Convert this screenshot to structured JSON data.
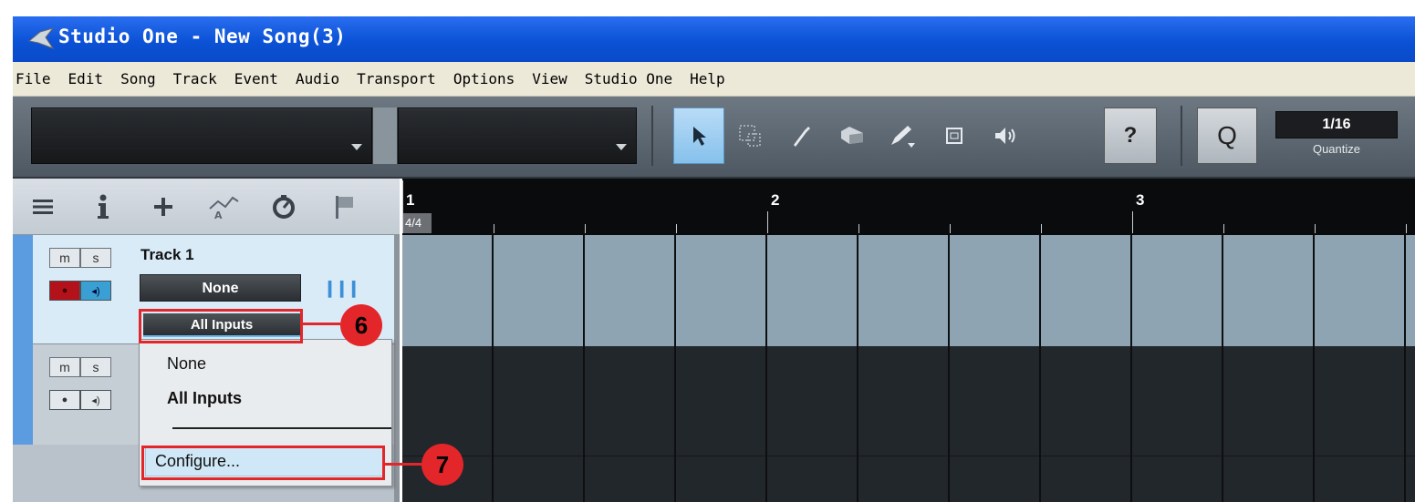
{
  "window": {
    "title": "Studio One  - New Song(3)"
  },
  "menu": [
    "File",
    "Edit",
    "Song",
    "Track",
    "Event",
    "Audio",
    "Transport",
    "Options",
    "View",
    "Studio One",
    "Help"
  ],
  "toolbar": {
    "tools": [
      "arrow-tool-icon",
      "range-tool-icon",
      "split-tool-icon",
      "eraser-tool-icon",
      "paint-tool-icon",
      "mute-tool-icon",
      "listen-tool-icon"
    ],
    "help_label": "?",
    "quantize_button": "Q",
    "quantize_value": "1/16",
    "quantize_label": "Quantize"
  },
  "ruler": {
    "bars": [
      "1",
      "2",
      "3"
    ],
    "time_signature": "4/4"
  },
  "tracks": [
    {
      "mute": "m",
      "solo": "s",
      "name": "Track 1",
      "output": "None",
      "input": "All Inputs"
    },
    {
      "mute": "m",
      "solo": "s"
    }
  ],
  "input_menu": {
    "items": [
      "None",
      "All Inputs"
    ],
    "configure": "Configure..."
  },
  "callouts": [
    "6",
    "7"
  ]
}
